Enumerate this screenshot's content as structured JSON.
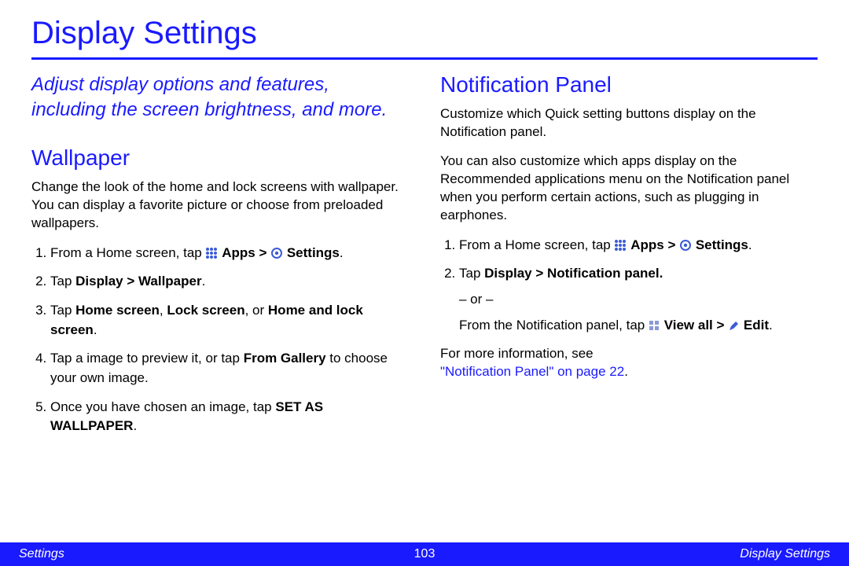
{
  "page_title": "Display Settings",
  "intro": "Adjust display options and features, including the screen brightness, and more.",
  "left": {
    "heading": "Wallpaper",
    "desc": "Change the look of the home and lock screens with wallpaper. You can display a favorite picture or choose from preloaded wallpapers.",
    "step1_pre": "From a Home screen, tap ",
    "apps_label": "Apps",
    "gt": " > ",
    "settings_label": "Settings",
    "step2_pre": "Tap ",
    "step2_bold": "Display > Wallpaper",
    "step3_pre": "Tap ",
    "step3_b1": "Home screen",
    "step3_sep1": ", ",
    "step3_b2": "Lock screen",
    "step3_sep2": ", or ",
    "step3_b3": "Home and lock screen",
    "step4_pre": "Tap a image to preview it, or tap ",
    "step4_bold": "From Gallery",
    "step4_post": " to choose your own image.",
    "step5_pre": " Once you have chosen an image, tap ",
    "step5_caps": "SET AS WALLPAPER",
    "period": "."
  },
  "right": {
    "heading": "Notification Panel",
    "desc1": "Customize which Quick setting buttons display on the Notification panel.",
    "desc2": "You can also customize which apps display on the Recommended applications menu on the Notification panel when you perform certain actions, such as plugging in earphones.",
    "step1_pre": "From a Home screen, tap ",
    "step2_pre": "Tap ",
    "step2_bold": "Display > Notification panel.",
    "or_line": "– or –",
    "step2b_pre": "From the Notification panel, tap ",
    "viewall_label": "View all",
    "gt": " > ",
    "edit_label": "Edit",
    "period": ".",
    "more_info": "For more information, see ",
    "link_text": "\"Notification Panel\" on page 22"
  },
  "footer": {
    "left": "Settings",
    "center": "103",
    "right": "Display Settings"
  },
  "icons": {
    "apps": "apps-grid-icon",
    "settings": "settings-gear-icon",
    "viewall": "tiles-icon",
    "edit": "pencil-icon"
  }
}
